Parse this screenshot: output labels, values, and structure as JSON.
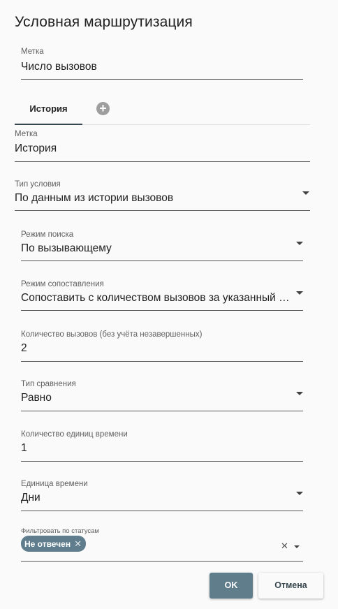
{
  "dialog": {
    "title": "Условная маршрутизация",
    "label_field": {
      "label": "Метка",
      "value": "Число вызовов"
    },
    "tabs": [
      {
        "label": "История"
      }
    ],
    "add_tab_glyph": "+",
    "history": {
      "label_field": {
        "label": "Метка",
        "value": "История"
      },
      "condition_type": {
        "label": "Тип условия",
        "value": "По данным из истории вызовов"
      },
      "search_mode": {
        "label": "Режим поиска",
        "value": "По вызывающему"
      },
      "match_mode": {
        "label": "Режим сопоставления",
        "value": "Сопоставить с количеством вызовов за указанный период"
      },
      "call_count": {
        "label": "Количество вызовов (без учёта незавершенных)",
        "value": "2"
      },
      "comparison_type": {
        "label": "Тип сравнения",
        "value": "Равно"
      },
      "time_units_count": {
        "label": "Количество единиц времени",
        "value": "1"
      },
      "time_unit": {
        "label": "Единица времени",
        "value": "Дни"
      },
      "status_filter": {
        "label": "Фильтровать по статусам",
        "chips": [
          {
            "label": "Не отвечен"
          }
        ],
        "chip_remove_glyph": "✕",
        "clear_glyph": "✕"
      }
    },
    "buttons": {
      "ok": "OK",
      "cancel": "Отмена"
    },
    "colors": {
      "primary": "#607d8b",
      "chip": "#5f7d8c",
      "tab_indicator": "#37474f"
    },
    "icons": [
      "add-circle-icon",
      "dropdown-arrow-icon",
      "chip-remove-icon",
      "clear-icon"
    ]
  }
}
